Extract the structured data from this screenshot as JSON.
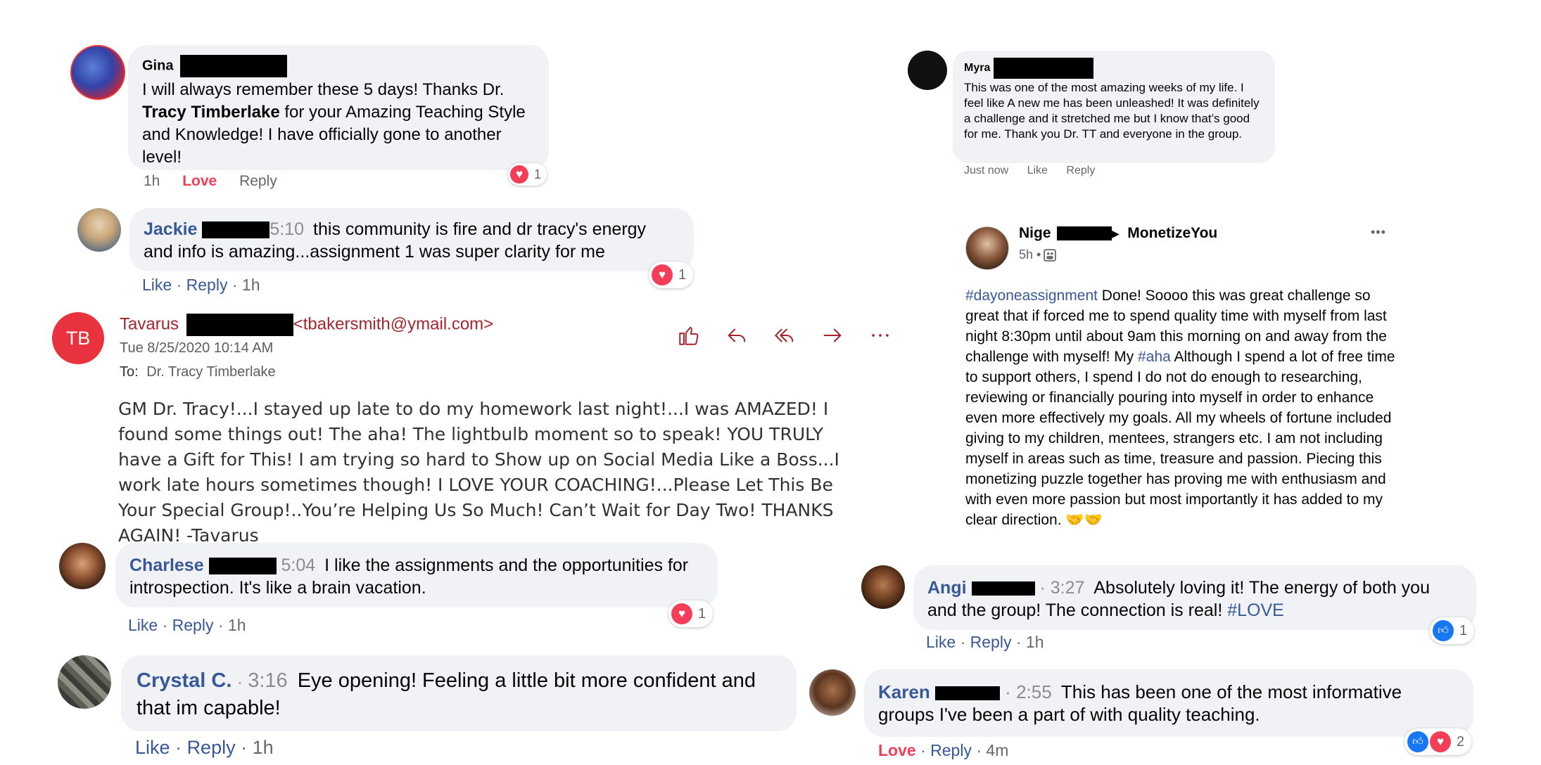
{
  "gina": {
    "name": "Gina",
    "text_1": "I will always remember these 5 days! Thanks Dr.",
    "text_bold": "Tracy Timberlake",
    "text_2": " for your Amazing Teaching Style and Knowledge! I have officially gone to another level!",
    "time": "1h",
    "love": "Love",
    "reply": "Reply",
    "reaction_count": "1"
  },
  "jackie": {
    "name": "Jackie",
    "time_inline": "5:10",
    "text": "this community is fire and dr tracy's energy and info is amazing...assignment 1 was super clarity for me",
    "like": "Like",
    "reply": "Reply",
    "age": "1h",
    "reaction_count": "1"
  },
  "email": {
    "avatar_initials": "TB",
    "avatar_color": "#e8323d",
    "from_name": "Tavarus",
    "from_address": "<tbakersmith@ymail.com>",
    "date": "Tue 8/25/2020 10:14 AM",
    "to_label": "To:",
    "to_name": "Dr. Tracy Timberlake",
    "body": "GM Dr. Tracy!...I stayed up late to do my homework last night!...I was AMAZED! I found some things out! The aha!  The lightbulb moment so to speak!   YOU TRULY have a Gift for This! I am trying so hard to Show up on Social Media Like a Boss...I work late hours sometimes though!  I LOVE YOUR COACHING!...Please Let This Be Your Special Group!..You’re Helping Us So Much!  Can’t Wait for Day Two!  THANKS AGAIN! -Tavarus",
    "toolbar_icons": [
      "thumbs-up-icon",
      "reply-icon",
      "reply-all-icon",
      "forward-icon",
      "more-icon"
    ]
  },
  "charlese": {
    "name": "Charlese",
    "time_inline": "5:04",
    "text": "I like the assignments and the opportunities for introspection. It's like a brain vacation.",
    "like": "Like",
    "reply": "Reply",
    "age": "1h",
    "reaction_count": "1"
  },
  "crystal": {
    "name": "Crystal C.",
    "time_inline": "3:16",
    "text": "Eye opening! Feeling a little bit more confident and that im capable!",
    "like": "Like",
    "reply": "Reply",
    "age": "1h"
  },
  "myra": {
    "name": "Myra",
    "text": "This was one of the most amazing weeks of my life. I feel like A new me has been unleashed! It was definitely a challenge and it stretched me but I know that’s good for me. Thank you Dr. TT and everyone in the group.",
    "time": "Just now",
    "like": "Like",
    "reply": "Reply"
  },
  "nige": {
    "name": "Nige",
    "arrow": "▶",
    "group": "MonetizeYou",
    "age": "5h •",
    "more": "•••",
    "hashtag_1": "#dayoneassignment",
    "text_1": " Done! Soooo this was great challenge so great that if forced me to spend quality time with myself from last night  8:30pm until about 9am this morning on and away from the challenge with myself! My ",
    "hashtag_2": "#aha",
    "text_2": " Although I spend a lot of free time to support others, I spend I do not do enough to researching, reviewing or financially pouring into myself in order to enhance even more effectively my goals. All my wheels of fortune included giving to my children, mentees, strangers etc. I am not including myself in areas such as time, treasure and passion. Piecing this monetizing puzzle together has proving me with enthusiasm and with even more passion but most importantly it has added to my clear direction. ",
    "emoji": "🤝🤝"
  },
  "angi": {
    "name": "Angi",
    "time_inline": "3:27",
    "text": "Absolutely loving it! The energy of both you and the group! The connection is real! ",
    "hashtag": "#LOVE",
    "like": "Like",
    "reply": "Reply",
    "age": "1h",
    "reaction_count": "1"
  },
  "karen": {
    "name": "Karen",
    "time_inline": "2:55",
    "text": "This has been one of the most informative groups I've been a part of with quality teaching.",
    "love": "Love",
    "reply": "Reply",
    "age": "4m",
    "reaction_count": "2"
  },
  "separators": {
    "dot": "·",
    "bullet": "•"
  },
  "colors": {
    "fb_link": "#385898",
    "love_red": "#f33e58",
    "email_accent": "#a4262c",
    "bubble_bg": "#f0f2f5"
  }
}
